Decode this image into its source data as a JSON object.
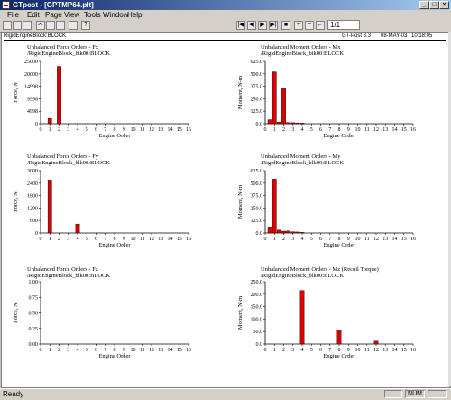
{
  "window": {
    "title": "GTpost - [GPTMP64.plt]"
  },
  "menu": [
    "File",
    "Edit",
    "Page",
    "View",
    "Tools",
    "Window",
    "Help"
  ],
  "toolbar": {
    "page_field": "1/1"
  },
  "doc_header": {
    "left": "RigidEngineBlock:BLOCK",
    "right_app": "GT-Post 3.3",
    "right_date": "08-MAY-03",
    "right_time": "10:18:05"
  },
  "charts": [
    {
      "title": "Unbalanced Force Orders - Fx",
      "subtitle": "/RigidEngineBlock_blk00:BLOCK",
      "ylabel": "Force, N",
      "xlabel": "Engine Order",
      "yticks": [
        "25000",
        "20000",
        "14998",
        "9998",
        "4998",
        "0"
      ],
      "ymax": 25000,
      "xticks": [
        "0",
        "1",
        "2",
        "3",
        "4",
        "5",
        "6",
        "7",
        "8",
        "9",
        "10",
        "11",
        "12",
        "13",
        "14",
        "15",
        "16"
      ],
      "chart_data": {
        "type": "bar",
        "x": [
          1,
          2
        ],
        "values": [
          2100,
          23000
        ],
        "xlim": [
          0,
          16
        ],
        "ylim": [
          0,
          25000
        ]
      }
    },
    {
      "title": "Unbalanced Moment Orders - Mx",
      "subtitle": "/RigidEngineBlock_blk00:BLOCK",
      "ylabel": "Moment, N-m",
      "xlabel": "Engine Order",
      "yticks": [
        "625.0",
        "500.0",
        "375.0",
        "250.0",
        "125.0",
        "0.0"
      ],
      "ymax": 625,
      "xticks": [
        "0",
        "1",
        "2",
        "3",
        "4",
        "5",
        "6",
        "7",
        "8",
        "9",
        "10",
        "11",
        "12",
        "13",
        "14",
        "15",
        "16"
      ],
      "chart_data": {
        "type": "bar",
        "x": [
          0.5,
          1,
          1.5,
          2,
          2.5,
          3,
          3.5,
          4
        ],
        "values": [
          40,
          520,
          15,
          355,
          12,
          10,
          8,
          6
        ],
        "xlim": [
          0,
          16
        ],
        "ylim": [
          0,
          625
        ]
      }
    },
    {
      "title": "Unbalanced Force Orders - Fy",
      "subtitle": "/RigidEngineBlock_blk00:BLOCK",
      "ylabel": "Force, N",
      "xlabel": "Engine Order",
      "yticks": [
        "3000",
        "2400",
        "1800",
        "1200",
        "600",
        "0"
      ],
      "ymax": 3000,
      "xticks": [
        "0",
        "1",
        "2",
        "3",
        "4",
        "5",
        "6",
        "7",
        "8",
        "9",
        "10",
        "11",
        "12",
        "13",
        "14",
        "15",
        "16"
      ],
      "chart_data": {
        "type": "bar",
        "x": [
          1,
          4
        ],
        "values": [
          2550,
          430
        ],
        "xlim": [
          0,
          16
        ],
        "ylim": [
          0,
          3000
        ]
      }
    },
    {
      "title": "Unbalanced Moment Orders - My",
      "subtitle": "/RigidEngineBlock_blk00:BLOCK",
      "ylabel": "Moment, N-m",
      "xlabel": "Engine Order",
      "yticks": [
        "625.0",
        "500.0",
        "375.0",
        "250.0",
        "125.0",
        "0.0"
      ],
      "ymax": 625,
      "xticks": [
        "0",
        "1",
        "2",
        "3",
        "4",
        "5",
        "6",
        "7",
        "8",
        "9",
        "10",
        "11",
        "12",
        "13",
        "14",
        "15",
        "16"
      ],
      "chart_data": {
        "type": "bar",
        "x": [
          0.5,
          1,
          1.5,
          2,
          2.5,
          3,
          3.5,
          4
        ],
        "values": [
          60,
          540,
          30,
          18,
          20,
          12,
          10,
          6
        ],
        "xlim": [
          0,
          16
        ],
        "ylim": [
          0,
          625
        ]
      }
    },
    {
      "title": "Unbalanced Force Orders - Fz",
      "subtitle": "/RigidEngineBlock_blk00:BLOCK",
      "ylabel": "Force, N",
      "xlabel": "Engine Order",
      "yticks": [
        "1.00",
        "0.75",
        "0.50",
        "0.25",
        "0.00"
      ],
      "ymax": 1,
      "xticks": [
        "0",
        "1",
        "2",
        "3",
        "4",
        "5",
        "6",
        "7",
        "8",
        "9",
        "10",
        "11",
        "12",
        "13",
        "14",
        "15",
        "16"
      ],
      "chart_data": {
        "type": "bar",
        "x": [],
        "values": [],
        "xlim": [
          0,
          16
        ],
        "ylim": [
          0,
          1
        ]
      }
    },
    {
      "title": "Unbalanced Moment Orders - Mz (Recoil Torque)",
      "subtitle": "/RigidEngineBlock_blk00:BLOCK",
      "ylabel": "Moment, N-m",
      "xlabel": "Engine Order",
      "yticks": [
        "250.0",
        "200.0",
        "150.0",
        "100.0",
        "50.0",
        "0.0"
      ],
      "ymax": 250,
      "xticks": [
        "0",
        "1",
        "2",
        "3",
        "4",
        "5",
        "6",
        "7",
        "8",
        "9",
        "10",
        "11",
        "12",
        "13",
        "14",
        "15",
        "16"
      ],
      "chart_data": {
        "type": "bar",
        "x": [
          4,
          8,
          12
        ],
        "values": [
          215,
          55,
          12
        ],
        "xlim": [
          0,
          16
        ],
        "ylim": [
          0,
          250
        ]
      }
    }
  ],
  "colors": {
    "bar": "#dd0000",
    "bar_edge": "#000000"
  },
  "status": {
    "text": "Ready",
    "num": "NUM"
  }
}
